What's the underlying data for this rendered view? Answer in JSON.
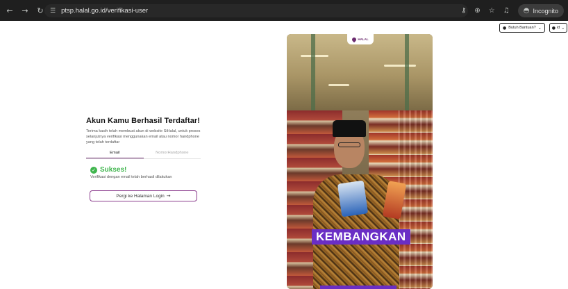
{
  "browser": {
    "url": "ptsp.halal.go.id/verifikasi-user",
    "incognito_label": "Incognito",
    "icons": [
      "back-icon",
      "forward-icon",
      "reload-icon",
      "site-settings-icon",
      "password-key-icon",
      "zoom-icon",
      "bookmark-star-icon",
      "media-icon",
      "incognito-icon"
    ]
  },
  "header": {
    "help_label": "Butuh Bantuan?",
    "lang_label": "id"
  },
  "main": {
    "title": "Akun Kamu Berhasil Terdaftar!",
    "description": "Terima kasih telah membuat akun di website SiHalal, untuk proses selanjutnya verifikasi menggunakan email atau nomor handphone yang telah terdaftar",
    "tabs": [
      {
        "label": "Email",
        "active": true
      },
      {
        "label": "NomorHandphone",
        "active": false
      }
    ],
    "success_title": "Sukses!",
    "success_desc": "Verifikasi dengan email telah berhasil dilakukan",
    "login_button": "Pergi ke Halaman Login"
  },
  "video": {
    "logo_text": "HALAL",
    "caption": "KEMBANGKAN"
  },
  "colors": {
    "accent": "#6b2b6e",
    "success": "#3fb54d",
    "caption_bg": "#6a2ec5"
  }
}
